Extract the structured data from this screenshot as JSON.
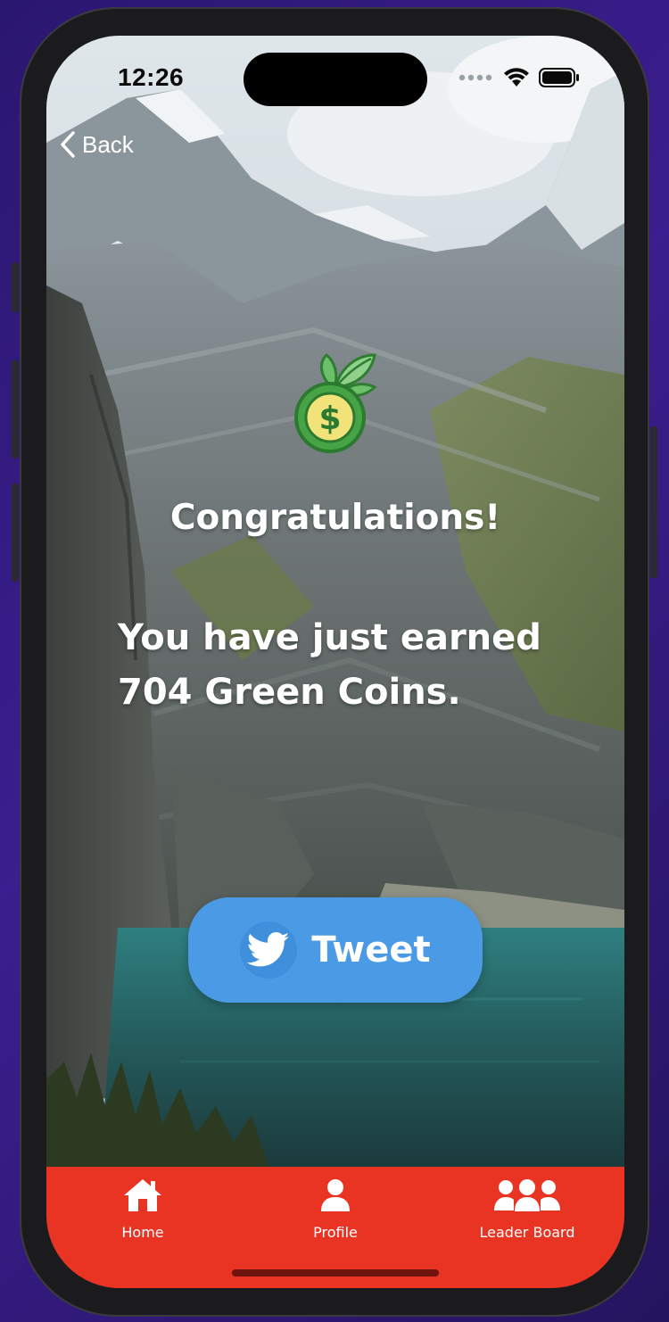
{
  "status_bar": {
    "time": "12:26",
    "icons": [
      "signal-dots-icon",
      "wifi-icon",
      "battery-icon"
    ]
  },
  "nav": {
    "back_label": "Back"
  },
  "reward": {
    "icon": "money-bag-coin-icon",
    "headline": "Congratulations!",
    "message_line1": "You have just earned",
    "message_line2": "704 Green Coins."
  },
  "share": {
    "tweet_label": "Tweet",
    "icon": "twitter-bird-icon"
  },
  "tabbar": {
    "items": [
      {
        "label": "Home",
        "icon": "home-icon"
      },
      {
        "label": "Profile",
        "icon": "person-icon"
      },
      {
        "label": "Leader Board",
        "icon": "group-icon"
      }
    ]
  },
  "colors": {
    "tabbar_bg": "#e93323",
    "tweet_button": "#4a9ae6",
    "coin_green": "#3e9b3a",
    "coin_yellow": "#f2e27a"
  }
}
